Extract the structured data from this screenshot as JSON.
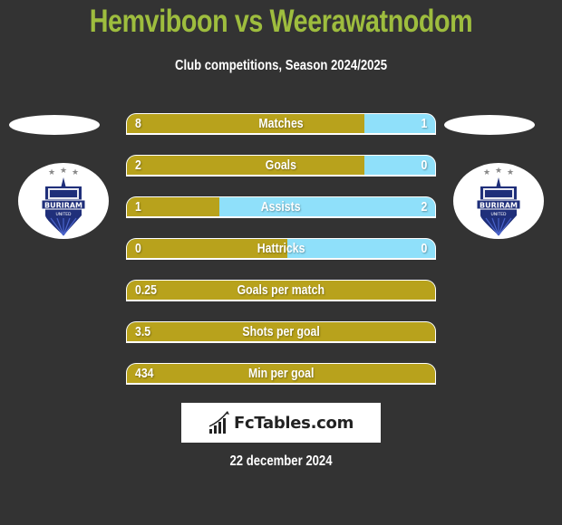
{
  "header": {
    "title": "Hemviboon vs Weerawatnodom",
    "subtitle": "Club competitions, Season 2024/2025"
  },
  "players": {
    "left": {
      "name": "Hemviboon",
      "club_badge": "buriram-united-badge",
      "club_text": "BURIRAM",
      "club_subtext": "UNITED"
    },
    "right": {
      "name": "Weerawatnodom",
      "club_badge": "buriram-united-badge",
      "club_text": "BURIRAM",
      "club_subtext": "UNITED"
    }
  },
  "colors": {
    "title": "#9ebd3e",
    "left_bar": "#b8a21c",
    "right_bar": "#8fe0fa",
    "background": "#333333"
  },
  "stats": [
    {
      "label": "Matches",
      "left": "8",
      "right": "1",
      "left_fraction": 0.77
    },
    {
      "label": "Goals",
      "left": "2",
      "right": "0",
      "left_fraction": 0.77
    },
    {
      "label": "Assists",
      "left": "1",
      "right": "2",
      "left_fraction": 0.3
    },
    {
      "label": "Hattricks",
      "left": "0",
      "right": "0",
      "left_fraction": 0.52
    },
    {
      "label": "Goals per match",
      "left": "0.25",
      "right": "",
      "left_fraction": 1.0
    },
    {
      "label": "Shots per goal",
      "left": "3.5",
      "right": "",
      "left_fraction": 1.0
    },
    {
      "label": "Min per goal",
      "left": "434",
      "right": "",
      "left_fraction": 1.0
    }
  ],
  "footer": {
    "logo_text": "FcTables.com",
    "date": "22 december 2024"
  }
}
